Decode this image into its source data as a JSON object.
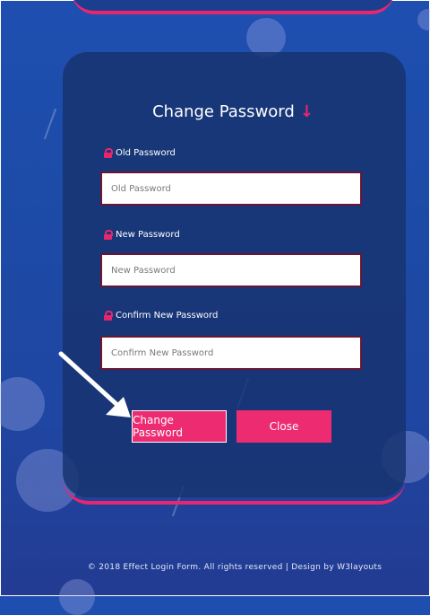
{
  "form": {
    "title": "Change Password",
    "title_icon": "arrow-down-icon",
    "fields": [
      {
        "label": "Old Password",
        "placeholder": "Old Password",
        "icon": "lock-icon"
      },
      {
        "label": "New Password",
        "placeholder": "New Password",
        "icon": "lock-icon"
      },
      {
        "label": "Confirm New Password",
        "placeholder": "Confirm New Password",
        "icon": "lock-icon"
      }
    ],
    "buttons": {
      "change_label": "Change Password",
      "close_label": "Close"
    }
  },
  "footer": {
    "text": "© 2018 Effect Login Form. All rights reserved | Design by W3layouts"
  },
  "colors": {
    "accent": "#ec2b71",
    "background": "#1e4fb0",
    "card": "#183470"
  }
}
